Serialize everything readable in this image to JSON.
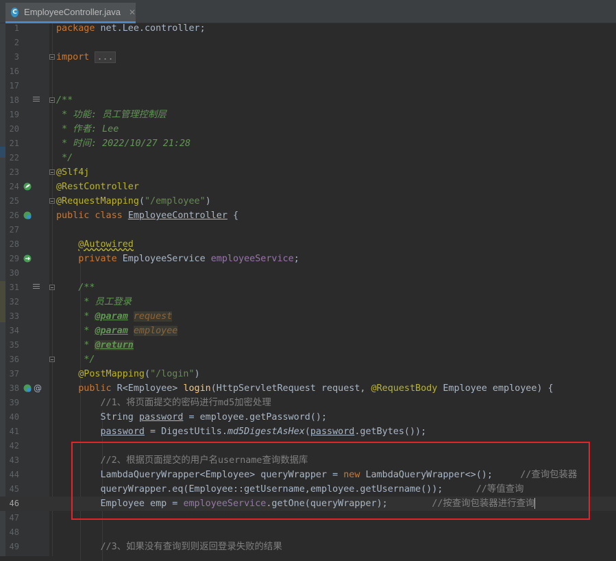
{
  "tab": {
    "label": "EmployeeController.java",
    "icon": "C",
    "close": "✕"
  },
  "lines": [
    {
      "n": "1",
      "text": "package net.Lee.controller;"
    },
    {
      "n": "2",
      "text": ""
    },
    {
      "n": "3",
      "text": "import ..."
    },
    {
      "n": "16",
      "text": ""
    },
    {
      "n": "17",
      "text": ""
    },
    {
      "n": "18",
      "text": "/**"
    },
    {
      "n": "19",
      "text": " * 功能: 员工管理控制层"
    },
    {
      "n": "20",
      "text": " * 作者: Lee"
    },
    {
      "n": "21",
      "text": " * 时间: 2022/10/27 21:28"
    },
    {
      "n": "22",
      "text": " */"
    },
    {
      "n": "23",
      "text": "@Slf4j"
    },
    {
      "n": "24",
      "text": "@RestController"
    },
    {
      "n": "25",
      "text": "@RequestMapping(\"/employee\")"
    },
    {
      "n": "26",
      "text": "public class EmployeeController {"
    },
    {
      "n": "27",
      "text": ""
    },
    {
      "n": "28",
      "text": "    @Autowired"
    },
    {
      "n": "29",
      "text": "    private EmployeeService employeeService;"
    },
    {
      "n": "30",
      "text": ""
    },
    {
      "n": "31",
      "text": "    /**"
    },
    {
      "n": "32",
      "text": "     * 员工登录"
    },
    {
      "n": "33",
      "text": "     * @param request"
    },
    {
      "n": "34",
      "text": "     * @param employee"
    },
    {
      "n": "35",
      "text": "     * @return"
    },
    {
      "n": "36",
      "text": "     */"
    },
    {
      "n": "37",
      "text": "    @PostMapping(\"/login\")"
    },
    {
      "n": "38",
      "text": "    public R<Employee> login(HttpServletRequest request, @RequestBody Employee employee) {"
    },
    {
      "n": "39",
      "text": "        //1、将页面提交的密码进行md5加密处理"
    },
    {
      "n": "40",
      "text": "        String password = employee.getPassword();"
    },
    {
      "n": "41",
      "text": "        password = DigestUtils.md5DigestAsHex(password.getBytes());"
    },
    {
      "n": "42",
      "text": ""
    },
    {
      "n": "43",
      "text": "        //2、根据页面提交的用户名username查询数据库"
    },
    {
      "n": "44",
      "text": "        LambdaQueryWrapper<Employee> queryWrapper = new LambdaQueryWrapper<>();     //查询包装器"
    },
    {
      "n": "45",
      "text": "        queryWrapper.eq(Employee::getUsername,employee.getUsername());      //等值查询"
    },
    {
      "n": "46",
      "text": "        Employee emp = employeeService.getOne(queryWrapper);        //按查询包装器进行查询"
    },
    {
      "n": "47",
      "text": ""
    },
    {
      "n": "48",
      "text": ""
    },
    {
      "n": "49",
      "text": "        //3、如果没有查询到则返回登录失败的结果"
    }
  ],
  "current_line": "46",
  "colors": {
    "background": "#2b2b2b",
    "keyword": "#cc7832",
    "annotation": "#bbb529",
    "string": "#6a8759",
    "field": "#9876aa",
    "doc": "#629755",
    "comment": "#808080",
    "method": "#ffc66d",
    "highlight_box": "#e0262a"
  }
}
